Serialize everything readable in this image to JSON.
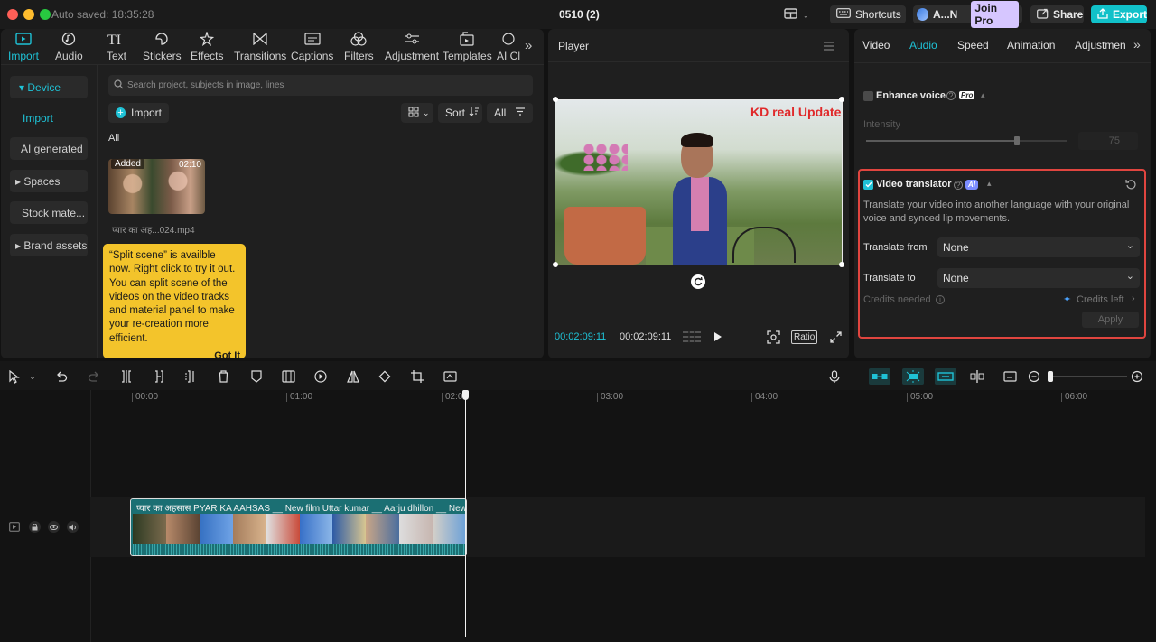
{
  "window": {
    "autosave": "Auto saved: 18:35:28",
    "title": "0510 (2)",
    "shortcuts_label": "Shortcuts",
    "account_label": "A...N",
    "join_pro_label": "Join Pro",
    "share_label": "Share",
    "export_label": "Export"
  },
  "toolbar": {
    "items": [
      {
        "label": "Import",
        "icon": "import-icon"
      },
      {
        "label": "Audio",
        "icon": "audio-icon"
      },
      {
        "label": "Text",
        "icon": "text-icon"
      },
      {
        "label": "Stickers",
        "icon": "stickers-icon"
      },
      {
        "label": "Effects",
        "icon": "effects-icon"
      },
      {
        "label": "Transitions",
        "icon": "transitions-icon"
      },
      {
        "label": "Captions",
        "icon": "captions-icon"
      },
      {
        "label": "Filters",
        "icon": "filters-icon"
      },
      {
        "label": "Adjustment",
        "icon": "adjustment-icon"
      },
      {
        "label": "Templates",
        "icon": "templates-icon"
      },
      {
        "label": "AI Cl",
        "icon": "ai-icon"
      }
    ],
    "more_glyph": "»"
  },
  "sidebar": {
    "device_label": "▾ Device",
    "import_label": "Import",
    "ai_generated_label": "AI generated",
    "spaces_label": "▸ Spaces",
    "stock_label": "Stock mate...",
    "brand_label": "▸ Brand assets"
  },
  "media": {
    "search_placeholder": "Search project, subjects in image, lines",
    "import_button": "Import",
    "sort_label": "Sort",
    "all_filter": "All",
    "section_label": "All",
    "clip": {
      "badge": "Added",
      "duration": "02:10",
      "filename": "प्यार का अह...024.mp4"
    },
    "tooltip": {
      "text": "“Split scene” is availble now. Right click to try it out. You can split scene of the videos on the video tracks and material panel to make your re-creation more efficient.",
      "button": "Got It"
    }
  },
  "player": {
    "title": "Player",
    "watermark": "KD real Update",
    "current_time": "00:02:09:11",
    "total_time": "00:02:09:11",
    "ratio_label": "Ratio"
  },
  "right_panel": {
    "tabs": [
      "Video",
      "Audio",
      "Speed",
      "Animation",
      "Adjustmen"
    ],
    "enhance_voice_label": "Enhance voice",
    "pro_badge": "Pro",
    "intensity_label": "Intensity",
    "intensity_value": "75",
    "intensity_fraction": 0.75,
    "translator": {
      "title": "Video translator",
      "ai_badge": "AI",
      "description": "Translate your video into another language with your original voice and synced lip movements.",
      "from_label": "Translate from",
      "from_value": "None",
      "to_label": "Translate to",
      "to_value": "None",
      "credits_needed": "Credits needed",
      "credits_left": "Credits left",
      "apply_label": "Apply"
    }
  },
  "timeline": {
    "ruler_labels": [
      "00:00",
      "01:00",
      "02:00",
      "03:00",
      "04:00",
      "05:00",
      "06:00"
    ],
    "clip_title": "प्यार का अहसास PYAR KA AAHSAS __ New film Uttar kumar __ Aarju dhillon __ New"
  },
  "colors": {
    "accent": "#1fc2d6",
    "export_bg": "#11c1c9",
    "highlight_border": "#e0453f",
    "clip_bg": "#1b6f73",
    "tooltip_bg": "#f3c42b"
  }
}
